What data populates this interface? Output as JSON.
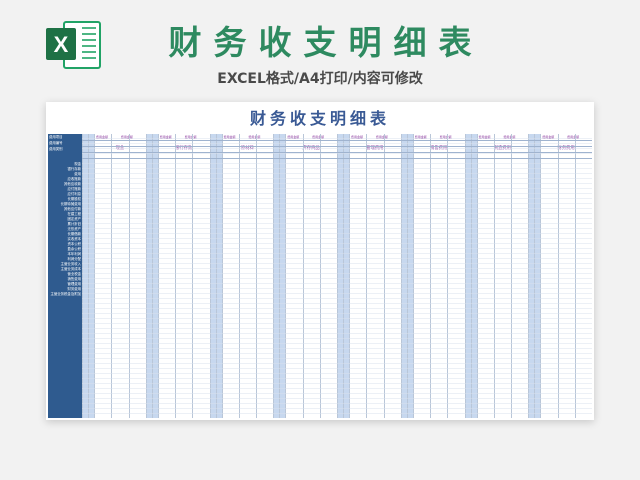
{
  "header": {
    "title": "财务收支明细表",
    "subtitle": "EXCEL格式/A4打印/内容可修改",
    "logo_icon": "excel-logo-icon",
    "brand_color": "#2e8a60",
    "logo_letter": "X"
  },
  "sheet": {
    "title": "财务收支明细表",
    "title_color": "#3a5a95",
    "header_left": [
      "费用项目",
      "费用编号",
      "费用类别"
    ],
    "left_labels": [
      "现金",
      "银行存款",
      "费用",
      "应收账款",
      "其他应收款",
      "应付账款",
      "应付利息",
      "长期股权",
      "长期待摊费用",
      "其他应付款",
      "在建工程",
      "固定资产",
      "累计折旧",
      "无形资产",
      "长期借款",
      "实收资本",
      "资本公积",
      "盈余公积",
      "本年利润",
      "利润分配",
      "主营业务收入",
      "主营业务成本",
      "营业税金",
      "销售费用",
      "管理费用",
      "财务费用",
      "主营业务税金及附加"
    ],
    "col_sub_headers": [
      "费用金额",
      "费用金额"
    ],
    "groups": [
      "现金",
      "银行存款",
      "原材料",
      "库存商品",
      "管理费用",
      "销售费用",
      "制造费用",
      "财务费用"
    ]
  }
}
